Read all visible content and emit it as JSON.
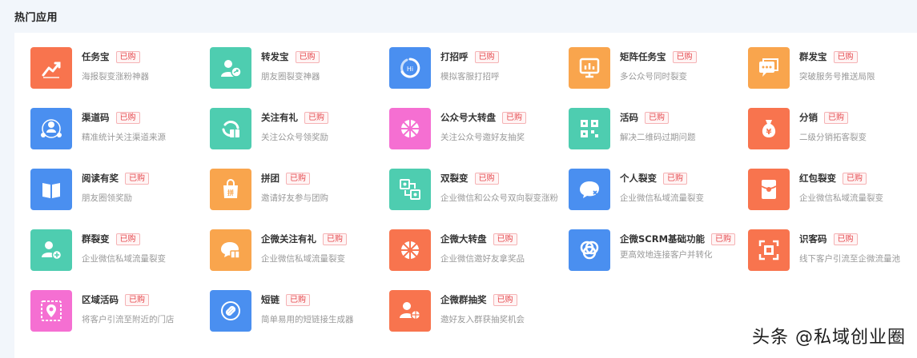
{
  "section": {
    "title": "热门应用"
  },
  "badge_label": "已购",
  "colors": {
    "orange": "#f8744e",
    "teal": "#4ecdb0",
    "blue": "#4a8ff0",
    "amber": "#f9a54d",
    "pink": "#f56fd2"
  },
  "apps": [
    {
      "name": "任务宝",
      "desc": "海报裂变涨粉神器",
      "icon": "chart-up-icon",
      "color": "#f8744e"
    },
    {
      "name": "转发宝",
      "desc": "朋友圈裂变神器",
      "icon": "user-share-icon",
      "color": "#4ecdb0"
    },
    {
      "name": "打招呼",
      "desc": "模拟客服打招呼",
      "icon": "greeting-icon",
      "color": "#4a8ff0"
    },
    {
      "name": "矩阵任务宝",
      "desc": "多公众号同时裂变",
      "icon": "matrix-chart-icon",
      "color": "#f9a54d"
    },
    {
      "name": "群发宝",
      "desc": "突破服务号推送局限",
      "icon": "broadcast-icon",
      "color": "#f9a54d"
    },
    {
      "name": "渠道码",
      "desc": "精准统计关注渠道来源",
      "icon": "channel-icon",
      "color": "#4a8ff0"
    },
    {
      "name": "关注有礼",
      "desc": "关注公众号领奖励",
      "icon": "follow-gift-icon",
      "color": "#4ecdb0"
    },
    {
      "name": "公众号大转盘",
      "desc": "关注公众号邀好友抽奖",
      "icon": "wheel-icon",
      "color": "#f56fd2"
    },
    {
      "name": "活码",
      "desc": "解决二维码过期问题",
      "icon": "qr-code-icon",
      "color": "#4ecdb0"
    },
    {
      "name": "分销",
      "desc": "二级分销拓客裂变",
      "icon": "money-bag-icon",
      "color": "#f8744e"
    },
    {
      "name": "阅读有奖",
      "desc": "朋友圈领奖励",
      "icon": "book-icon",
      "color": "#4a8ff0"
    },
    {
      "name": "拼团",
      "desc": "邀请好友参与团购",
      "icon": "shopping-bag-icon",
      "color": "#f9a54d"
    },
    {
      "name": "双裂变",
      "desc": "企业微信和公众号双向裂变涨粉",
      "icon": "double-fission-icon",
      "color": "#4ecdb0"
    },
    {
      "name": "个人裂变",
      "desc": "企业微信私域流量裂变",
      "icon": "chat-bubble-icon",
      "color": "#4a8ff0"
    },
    {
      "name": "红包裂变",
      "desc": "企业微信私域流量裂变",
      "icon": "red-packet-icon",
      "color": "#f8744e"
    },
    {
      "name": "群裂变",
      "desc": "企业微信私域流量裂变",
      "icon": "group-fission-icon",
      "color": "#4ecdb0"
    },
    {
      "name": "企微关注有礼",
      "desc": "企业微信私域流量裂变",
      "icon": "wecom-gift-icon",
      "color": "#f9a54d"
    },
    {
      "name": "企微大转盘",
      "desc": "企业微信邀好友拿奖品",
      "icon": "wheel-icon",
      "color": "#f8744e"
    },
    {
      "name": "企微SCRM基础功能",
      "desc": "更高效地连接客户并转化",
      "icon": "scrm-icon",
      "color": "#4a8ff0"
    },
    {
      "name": "识客码",
      "desc": "线下客户引流至企微流量池",
      "icon": "scan-code-icon",
      "color": "#f8744e"
    },
    {
      "name": "区域活码",
      "desc": "将客户引流至附近的门店",
      "icon": "location-qr-icon",
      "color": "#f56fd2"
    },
    {
      "name": "短链",
      "desc": "简单易用的短链接生成器",
      "icon": "link-icon",
      "color": "#4a8ff0"
    },
    {
      "name": "企微群抽奖",
      "desc": "邀好友入群获抽奖机会",
      "icon": "group-lottery-icon",
      "color": "#f8744e"
    }
  ],
  "watermark": "头条 @私域创业圈"
}
